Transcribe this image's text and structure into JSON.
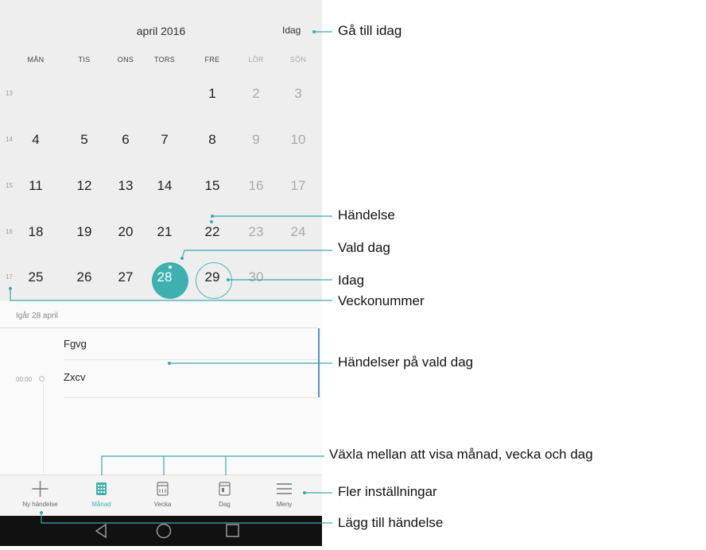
{
  "header": {
    "month_title": "april 2016",
    "today_button": "Idag"
  },
  "weekdays": [
    "MÅN",
    "TIS",
    "ONS",
    "TORS",
    "FRE",
    "LÖR",
    "SÖN"
  ],
  "weeks": [
    {
      "number": "13",
      "days": [
        "",
        "",
        "",
        "",
        "1",
        "2",
        "3"
      ]
    },
    {
      "number": "14",
      "days": [
        "4",
        "5",
        "6",
        "7",
        "8",
        "9",
        "10"
      ]
    },
    {
      "number": "15",
      "days": [
        "11",
        "12",
        "13",
        "14",
        "15",
        "16",
        "17"
      ]
    },
    {
      "number": "16",
      "days": [
        "18",
        "19",
        "20",
        "21",
        "22",
        "23",
        "24"
      ]
    },
    {
      "number": "17",
      "days": [
        "25",
        "26",
        "27",
        "28",
        "29",
        "30",
        ""
      ]
    }
  ],
  "selected_day": "28",
  "today": "29",
  "event_list": {
    "date_label": "Igår 28 april",
    "events": [
      {
        "time": "",
        "title": "Fgvg"
      },
      {
        "time": "00:00",
        "title": "Zxcv"
      }
    ]
  },
  "tabs": [
    {
      "label": "Ny händelse",
      "icon": "plus-icon",
      "active": false
    },
    {
      "label": "Månad",
      "icon": "month-grid-icon",
      "active": true
    },
    {
      "label": "Vecka",
      "icon": "week-calendar-icon",
      "active": false
    },
    {
      "label": "Dag",
      "icon": "day-calendar-icon",
      "active": false
    },
    {
      "label": "Meny",
      "icon": "menu-icon",
      "active": false
    }
  ],
  "nav_icons": [
    "back-icon",
    "home-icon",
    "recents-icon"
  ],
  "callouts": {
    "go_today": "Gå till idag",
    "event": "Händelse",
    "selected_day": "Vald dag",
    "today": "Idag",
    "week_number": "Veckonummer",
    "events_on_day": "Händelser på vald dag",
    "switch_view": "Växla mellan att visa månad, vecka och dag",
    "more_settings": "Fler inställningar",
    "add_event": "Lägg till händelse"
  },
  "colors": {
    "accent": "#3fb0b0",
    "callout_line": "#3aa9b0",
    "scroll": "#5a8fd0"
  }
}
